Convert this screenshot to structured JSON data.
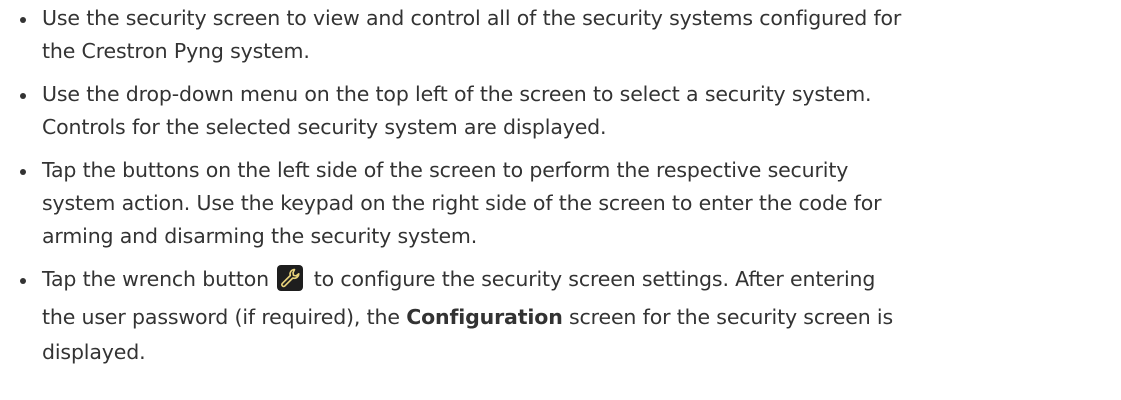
{
  "bullets": [
    {
      "lines": [
        "Use the security screen to view and control all of the security systems configured for",
        "the Crestron Pyng system."
      ]
    },
    {
      "lines": [
        "Use the drop-down menu on the top left of the screen to select a security system.",
        "Controls for the selected security system are displayed."
      ]
    },
    {
      "lines": [
        "Tap the buttons on the left side of the screen to perform the respective security",
        "system action. Use the keypad on the right side of the screen to enter the code for",
        "arming and disarming the security system."
      ]
    },
    {
      "line1_before_icon": "Tap the wrench button",
      "line1_after_icon": "to configure the security screen settings. After entering",
      "line2_before_bold": "the user password (if required), the",
      "line2_bold": "Configuration",
      "line2_after_bold": "screen for the security screen is",
      "line3": "displayed.",
      "icon": "wrench-icon"
    }
  ]
}
